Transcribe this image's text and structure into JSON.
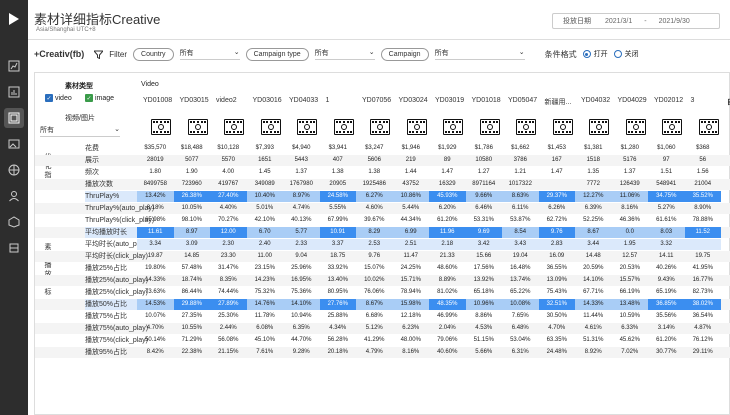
{
  "app": {
    "title": "素材详细指标Creative",
    "timezone": "Asia/Shanghai UTC+8"
  },
  "date": {
    "label": "投放日期",
    "start": "2021/3/1",
    "sep": "-",
    "end": "2021/9/30"
  },
  "filters": {
    "brand": "+Creativ(fb)",
    "filter_label": "Filter",
    "country_pill": "Country",
    "country_value": "所有",
    "campaign_type_pill": "Campaign type",
    "campaign_type_value": "所有",
    "campaign_pill": "Campaign",
    "campaign_value": "所有",
    "format_label": "条件格式",
    "open": "打开",
    "close": "关闭"
  },
  "left": {
    "material_type": "素材类型",
    "video": "video",
    "image": "image",
    "preview": "视频/图片",
    "all": "所有"
  },
  "col_header_top": "Video",
  "columns": [
    "YD01008",
    "YD03015",
    "video2",
    "YD03016",
    "YD04033",
    "1",
    "YD07056",
    "YD03024",
    "YD03019",
    "YD01018",
    "YD05047",
    "新疆用...",
    "YD04032",
    "YD04029",
    "YD02012",
    "3",
    "自动"
  ],
  "sections": {
    "a": "优化指标",
    "b": "素材播放指标"
  },
  "rows": [
    {
      "label": "花费",
      "vals": [
        "$35,570",
        "$18,488",
        "$10,128",
        "$7,393",
        "$4,940",
        "$3,941",
        "$3,247",
        "$1,946",
        "$1,929",
        "$1,786",
        "$1,662",
        "$1,453",
        "$1,381",
        "$1,280",
        "$1,060",
        "$368"
      ]
    },
    {
      "label": "展示",
      "vals": [
        "28019",
        "5077",
        "5570",
        "1651",
        "5443",
        "407",
        "5606",
        "219",
        "89",
        "10580",
        "3786",
        "167",
        "1518",
        "5176",
        "97",
        "56"
      ]
    },
    {
      "label": "频次",
      "vals": [
        "1.80",
        "1.90",
        "4.00",
        "1.45",
        "1.37",
        "1.38",
        "1.38",
        "1.44",
        "1.47",
        "1.27",
        "1.21",
        "1.47",
        "1.35",
        "1.37",
        "1.51",
        "1.56"
      ]
    },
    {
      "label": "播放次数",
      "vals": [
        "8499758",
        "723960",
        "419767",
        "349089",
        "1767980",
        "20905",
        "1925486",
        "43752",
        "16329",
        "8971164",
        "1017322",
        "",
        "7772",
        "126439",
        "548941",
        "21004"
      ]
    },
    {
      "label": "ThruPlay%",
      "vals": [
        "13.42%",
        "26.38%",
        "27.40%",
        "10.40%",
        "8.97%",
        "24.58%",
        "6.27%",
        "10.86%",
        "45.93%",
        "9.66%",
        "8.63%",
        "29.37%",
        "12.27%",
        "11.06%",
        "34.75%",
        "35.52%"
      ]
    },
    {
      "label": "ThruPlay%(auto_play)",
      "vals": [
        "8.18%",
        "10.05%",
        "4.40%",
        "5.01%",
        "4.74%",
        "5.55%",
        "4.60%",
        "5.44%",
        "6.20%",
        "6.46%",
        "6.11%",
        "6.26%",
        "6.39%",
        "8.16%",
        "5.27%",
        "8.90%"
      ]
    },
    {
      "label": "ThruPlay%(click_play)",
      "vals": [
        "65.98%",
        "98.10%",
        "70.27%",
        "42.10%",
        "40.13%",
        "67.99%",
        "39.67%",
        "44.34%",
        "61.20%",
        "53.31%",
        "53.87%",
        "62.72%",
        "52.25%",
        "46.36%",
        "61.61%",
        "78.88%"
      ]
    },
    {
      "label": "平均播放时长",
      "vals": [
        "11.61",
        "8.97",
        "12.00",
        "6.70",
        "5.77",
        "10.91",
        "8.29",
        "6.99",
        "11.96",
        "9.69",
        "8.54",
        "9.76",
        "8.67",
        "0.0",
        "8.03",
        "11.52"
      ]
    },
    {
      "label": "平均时长(auto_play)",
      "vals": [
        "3.34",
        "3.09",
        "2.30",
        "2.40",
        "2.33",
        "3.37",
        "2.53",
        "2.51",
        "2.18",
        "3.42",
        "3.43",
        "2.83",
        "3.44",
        "1.95",
        "3.32",
        ""
      ]
    },
    {
      "label": "平均时长(click_play)",
      "vals": [
        "19.87",
        "14.85",
        "23.30",
        "11.00",
        "9.04",
        "18.75",
        "9.76",
        "11.47",
        "21.33",
        "15.66",
        "19.04",
        "16.09",
        "14.48",
        "12.57",
        "14.11",
        "19.75"
      ]
    },
    {
      "label": "播放25%占比",
      "vals": [
        "19.80%",
        "57.48%",
        "31.47%",
        "23.15%",
        "25.96%",
        "33.92%",
        "15.07%",
        "24.25%",
        "48.60%",
        "17.56%",
        "16.48%",
        "36.55%",
        "20.59%",
        "20.53%",
        "40.26%",
        "41.95%"
      ]
    },
    {
      "label": "播放25%(auto_play)",
      "vals": [
        "14.33%",
        "18.74%",
        "8.35%",
        "14.23%",
        "16.95%",
        "13.40%",
        "10.02%",
        "15.71%",
        "8.89%",
        "13.92%",
        "13.74%",
        "13.09%",
        "14.10%",
        "15.57%",
        "9.43%",
        "16.77%"
      ]
    },
    {
      "label": "播放25%(click_play)",
      "vals": [
        "73.63%",
        "86.44%",
        "74.44%",
        "75.32%",
        "75.36%",
        "80.95%",
        "76.06%",
        "78.94%",
        "81.02%",
        "65.18%",
        "65.22%",
        "75.43%",
        "67.71%",
        "66.19%",
        "65.19%",
        "82.73%"
      ]
    },
    {
      "label": "播放50%占比",
      "vals": [
        "14.53%",
        "29.88%",
        "27.89%",
        "14.76%",
        "14.10%",
        "27.76%",
        "8.67%",
        "15.98%",
        "48.35%",
        "10.96%",
        "10.08%",
        "32.51%",
        "14.33%",
        "13.48%",
        "36.85%",
        "38.02%"
      ]
    },
    {
      "label": "播放75%占比",
      "vals": [
        "10.07%",
        "27.35%",
        "25.30%",
        "11.78%",
        "10.94%",
        "25.88%",
        "6.68%",
        "12.18%",
        "46.99%",
        "8.86%",
        "7.65%",
        "30.50%",
        "11.44%",
        "10.59%",
        "35.56%",
        "36.54%"
      ]
    },
    {
      "label": "播放75%(auto_play)",
      "vals": [
        "4.70%",
        "10.55%",
        "2.44%",
        "6.08%",
        "6.35%",
        "4.34%",
        "5.12%",
        "6.23%",
        "2.04%",
        "4.53%",
        "6.48%",
        "4.70%",
        "4.61%",
        "6.33%",
        "3.14%",
        "4.87%"
      ]
    },
    {
      "label": "播放75%(click_play)",
      "vals": [
        "50.14%",
        "71.29%",
        "56.08%",
        "45.10%",
        "44.70%",
        "56.28%",
        "41.29%",
        "48.00%",
        "79.06%",
        "51.15%",
        "53.04%",
        "63.35%",
        "51.31%",
        "45.62%",
        "61.20%",
        "76.12%"
      ]
    },
    {
      "label": "播放95%占比",
      "vals": [
        "8.42%",
        "22.38%",
        "21.15%",
        "7.61%",
        "9.28%",
        "20.18%",
        "4.79%",
        "8.16%",
        "40.60%",
        "5.66%",
        "6.31%",
        "24.48%",
        "8.92%",
        "7.02%",
        "30.77%",
        "29.11%"
      ]
    }
  ],
  "highlight": {
    "rows": [
      4,
      7,
      13
    ],
    "color": "#3b8ef0",
    "light": "#dbe9fb",
    "mid": "#a9cdf6"
  },
  "sidebar_icons": [
    "play-logo-icon",
    "chart-icon",
    "table-icon",
    "image-icon",
    "globe-icon",
    "user-icon",
    "box-icon",
    "tag-icon"
  ]
}
